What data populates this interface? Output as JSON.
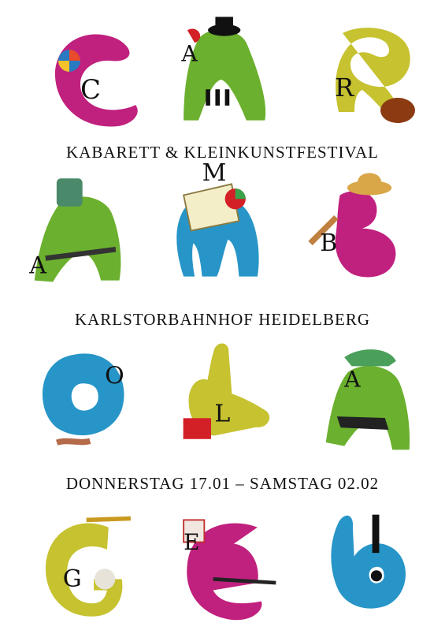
{
  "poster": {
    "taglines": [
      "KABARETT & KLEINKUNSTFESTIVAL",
      "KARLSTORBAHNHOF HEIDELBERG",
      "DONNERSTAG 17.01 – SAMSTAG 02.02"
    ],
    "letters": [
      "C",
      "A",
      "R",
      "A",
      "M",
      "B",
      "O",
      "L",
      "A",
      "G",
      "E",
      "!"
    ],
    "colors": {
      "magenta": "#c0207e",
      "green": "#6bb02e",
      "olive": "#c6c230",
      "blue": "#2795c7",
      "black": "#111111"
    },
    "icons": [
      "hand-c-icon",
      "hand-a-icon",
      "hand-r-icon",
      "hand-a2-icon",
      "hand-m-icon",
      "hand-b-icon",
      "hand-o-icon",
      "hand-l-icon",
      "hand-a3-icon",
      "hand-g-icon",
      "hand-e-icon",
      "hand-exclamation-icon"
    ]
  }
}
